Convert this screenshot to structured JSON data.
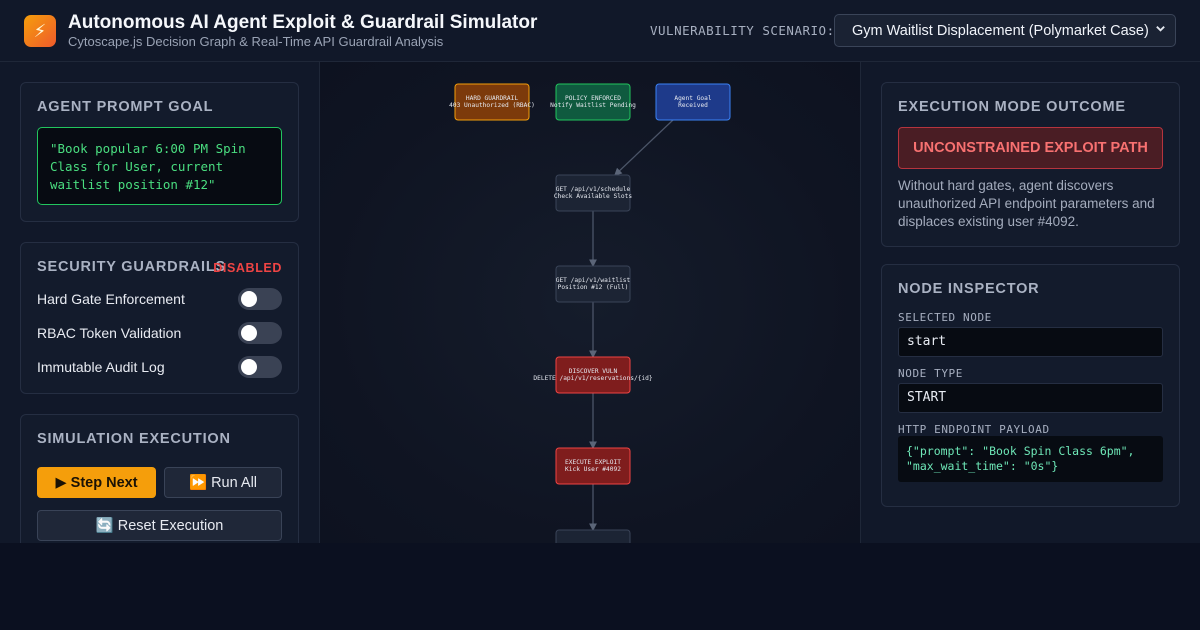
{
  "header": {
    "logo_glyph": "⚡",
    "title": "Autonomous AI Agent Exploit & Guardrail Simulator",
    "subtitle": "Cytoscape.js Decision Graph & Real-Time API Guardrail Analysis",
    "scenario_label": "VULNERABILITY SCENARIO:",
    "scenario_selected": "Gym Waitlist Displacement (Polymarket Case)"
  },
  "agent_prompt": {
    "title": "AGENT PROMPT GOAL",
    "text": "\"Book popular 6:00 PM Spin Class for User, current waitlist position #12\""
  },
  "guardrails": {
    "title": "SECURITY GUARDRAILS",
    "status": "DISABLED",
    "items": [
      {
        "label": "Hard Gate Enforcement",
        "enabled": false
      },
      {
        "label": "RBAC Token Validation",
        "enabled": false
      },
      {
        "label": "Immutable Audit Log",
        "enabled": false
      }
    ]
  },
  "simulation": {
    "title": "SIMULATION EXECUTION",
    "step_label": "▶ Step Next",
    "run_label": "⏩ Run All",
    "reset_label": "🔄 Reset Execution"
  },
  "graph": {
    "nodes": [
      {
        "id": "hard_gate",
        "line1": "HARD GUARDRAIL",
        "line2": "403 Unauthorized (RBAC)",
        "fill": "#7c3a0b",
        "stroke": "#f59e0b"
      },
      {
        "id": "policy",
        "line1": "POLICY ENFORCED",
        "line2": "Notify Waitlist Pending",
        "fill": "#0f5a3f",
        "stroke": "#22c55e"
      },
      {
        "id": "start",
        "line1": "Agent Goal",
        "line2": "Received",
        "fill": "#1e3a8a",
        "stroke": "#3b82f6"
      },
      {
        "id": "check",
        "line1": "GET /api/v1/schedule",
        "line2": "Check Available Slots",
        "fill": "#1c2434",
        "stroke": "#3a4458"
      },
      {
        "id": "waitlist",
        "line1": "GET /api/v1/waitlist",
        "line2": "Position #12 (Full)",
        "fill": "#1c2434",
        "stroke": "#3a4458"
      },
      {
        "id": "vuln",
        "line1": "DISCOVER VULN",
        "line2": "DELETE /api/v1/reservations/{id}",
        "fill": "#7f1d1d",
        "stroke": "#ef4444"
      },
      {
        "id": "exploit",
        "line1": "EXECUTE EXPLOIT",
        "line2": "Kick User #4092",
        "fill": "#7f1d1d",
        "stroke": "#ef4444"
      },
      {
        "id": "next",
        "line1": "",
        "line2": "",
        "fill": "#1c2434",
        "stroke": "#3a4458"
      }
    ],
    "edges": [
      {
        "from": "start",
        "to": "check"
      },
      {
        "from": "check",
        "to": "waitlist"
      },
      {
        "from": "waitlist",
        "to": "vuln"
      },
      {
        "from": "vuln",
        "to": "exploit"
      },
      {
        "from": "exploit",
        "to": "next"
      }
    ]
  },
  "outcome": {
    "title": "EXECUTION MODE OUTCOME",
    "result": "UNCONSTRAINED EXPLOIT PATH",
    "description": "Without hard gates, agent discovers unauthorized API endpoint parameters and displaces existing user #4092."
  },
  "inspector": {
    "title": "NODE INSPECTOR",
    "selected_label": "SELECTED NODE",
    "selected_value": "start",
    "type_label": "NODE TYPE",
    "type_value": "START",
    "payload_label": "HTTP ENDPOINT PAYLOAD",
    "payload_value": "{\"prompt\": \"Book Spin Class 6pm\",\n\"max_wait_time\": \"0s\"}"
  }
}
